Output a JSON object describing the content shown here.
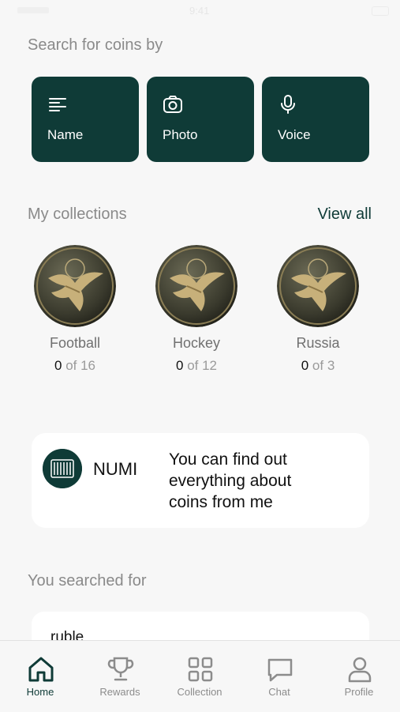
{
  "status_bar": {
    "time": "9:41"
  },
  "search": {
    "title": "Search for coins by",
    "buttons": [
      {
        "label": "Name",
        "icon": "list-icon"
      },
      {
        "label": "Photo",
        "icon": "camera-icon"
      },
      {
        "label": "Voice",
        "icon": "microphone-icon"
      }
    ]
  },
  "collections": {
    "title": "My collections",
    "view_all": "View all",
    "items": [
      {
        "name": "Football",
        "have": "0",
        "of_total": "of 16"
      },
      {
        "name": "Hockey",
        "have": "0",
        "of_total": "of 12"
      },
      {
        "name": "Russia",
        "have": "0",
        "of_total": "of 3"
      }
    ]
  },
  "assistant": {
    "name": "NUMI",
    "message": "You can find out everything about coins from me"
  },
  "recent": {
    "title": "You searched for",
    "items": [
      "ruble"
    ]
  },
  "tabs": [
    {
      "label": "Home",
      "icon": "home-icon",
      "active": true
    },
    {
      "label": "Rewards",
      "icon": "trophy-icon",
      "active": false
    },
    {
      "label": "Collection",
      "icon": "grid-icon",
      "active": false
    },
    {
      "label": "Chat",
      "icon": "chat-bubble-icon",
      "active": false
    },
    {
      "label": "Profile",
      "icon": "person-icon",
      "active": false
    }
  ],
  "colors": {
    "accent": "#0f3b37",
    "background": "#f7f7f7",
    "muted_text": "#8a8a8a"
  }
}
